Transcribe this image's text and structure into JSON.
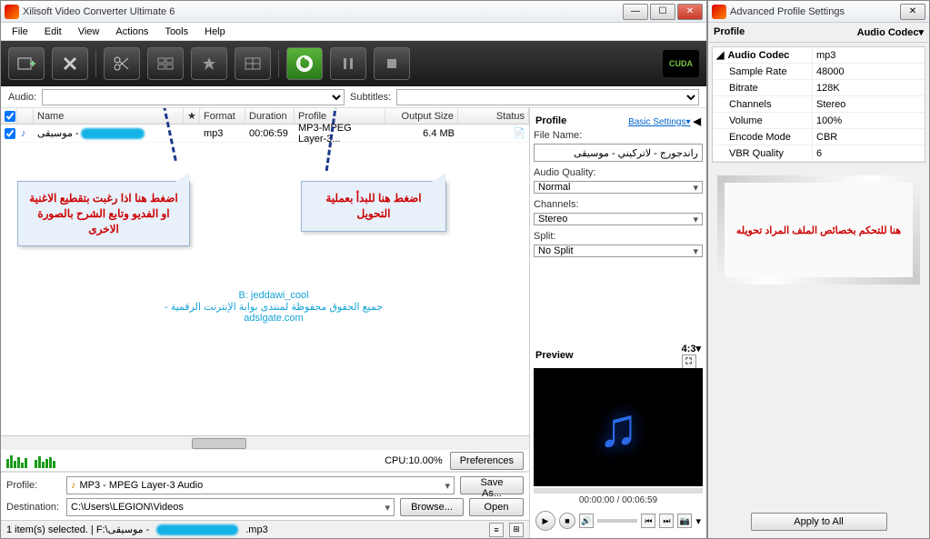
{
  "mainWindow": {
    "title": "Xilisoft Video Converter Ultimate 6",
    "menu": [
      "File",
      "Edit",
      "View",
      "Actions",
      "Tools",
      "Help"
    ],
    "cuda": "CUDA",
    "audioLabel": "Audio:",
    "subtitlesLabel": "Subtitles:",
    "columns": {
      "name": "Name",
      "format": "Format",
      "duration": "Duration",
      "profile": "Profile",
      "outputSize": "Output Size",
      "status": "Status"
    },
    "row": {
      "name": "- موسيقى",
      "format": "mp3",
      "duration": "00:06:59",
      "profile": "MP3-MPEG Layer-3...",
      "outputSize": "6.4 MB"
    },
    "annotation1": "اضغط هنا اذا رغبت بتقطيع الاغنية او  الفديو وتابع الشرح بالصورة الاخرى",
    "annotation2": "اضغط هنا للبدأ بعملية التحويل",
    "credit1": "B: jeddawi_cool",
    "credit2": "جميع الحقوق محفوظة لمنتدى بوابة الإنترنت الرقمية - adslgate.com",
    "cpu": "CPU:10.00%",
    "preferences": "Preferences",
    "profileLabel": "Profile:",
    "profileValue": "MP3 - MPEG Layer-3 Audio",
    "saveAs": "Save As...",
    "destinationLabel": "Destination:",
    "destinationValue": "C:\\Users\\LEGION\\Videos",
    "browse": "Browse...",
    "open": "Open",
    "statusbar": "1 item(s) selected. | F:\\موسيقى -",
    "statusbarExt": ".mp3"
  },
  "rightPanel": {
    "profileHeader": "Profile",
    "basicSettings": "Basic Settings▾",
    "fileNameLabel": "File Name:",
    "fileNameValue": "راندجورج - لاتركيني - موسيقى",
    "audioQualityLabel": "Audio Quality:",
    "audioQualityValue": "Normal",
    "channelsLabel": "Channels:",
    "channelsValue": "Stereo",
    "splitLabel": "Split:",
    "splitValue": "No Split",
    "previewHeader": "Preview",
    "aspectRatio": "4:3▾",
    "timecode": "00:00:00 / 00:06:59"
  },
  "auxWindow": {
    "title": "Advanced Profile Settings",
    "profileHeader": "Profile",
    "audioCodecHeader": "Audio Codec▾",
    "props": [
      {
        "k": "Audio Codec",
        "v": "mp3",
        "head": true
      },
      {
        "k": "Sample Rate",
        "v": "48000"
      },
      {
        "k": "Bitrate",
        "v": "128K"
      },
      {
        "k": "Channels",
        "v": "Stereo"
      },
      {
        "k": "Volume",
        "v": "100%"
      },
      {
        "k": "Encode Mode",
        "v": "CBR"
      },
      {
        "k": "VBR Quality",
        "v": "6"
      }
    ],
    "note": "هنا للتحكم بخصائص الملف المراد تحويله",
    "applyAll": "Apply to All"
  }
}
